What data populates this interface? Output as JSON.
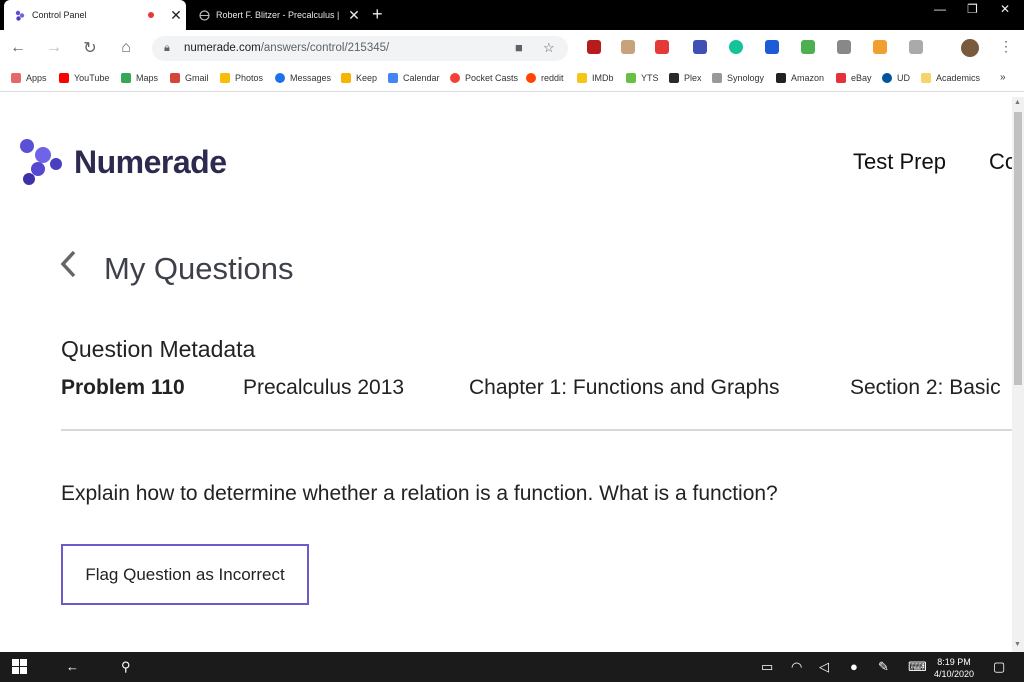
{
  "browser": {
    "tabs": [
      {
        "title": "Control Panel",
        "active": true
      },
      {
        "title": "Robert F. Blitzer - Precalculus |",
        "active": false
      }
    ],
    "url_domain": "numerade.com",
    "url_path": "/answers/control/215345/",
    "bookmarks": [
      "Apps",
      "YouTube",
      "Maps",
      "Gmail",
      "Photos",
      "Messages",
      "Keep",
      "Calendar",
      "Pocket Casts",
      "reddit",
      "IMDb",
      "YTS",
      "Plex",
      "Synology",
      "Amazon",
      "eBay",
      "UD",
      "Academics"
    ],
    "more_bookmarks": "»"
  },
  "site": {
    "logo_text": "Numerade",
    "nav": [
      "Test Prep",
      "Co"
    ]
  },
  "main": {
    "heading": "My Questions",
    "metadata_label": "Question Metadata",
    "metadata": [
      "Problem 110",
      "Precalculus 2013",
      "Chapter 1: Functions and Graphs",
      "Section 2: Basic"
    ],
    "question": "Explain how to determine whether a relation is a function. What is a function?",
    "flag_button": "Flag Question as Incorrect"
  },
  "taskbar": {
    "time": "8:19 PM",
    "date": "4/10/2020"
  },
  "colors": {
    "brand": "#5b4fd6",
    "button_border": "#6e5ac8"
  }
}
